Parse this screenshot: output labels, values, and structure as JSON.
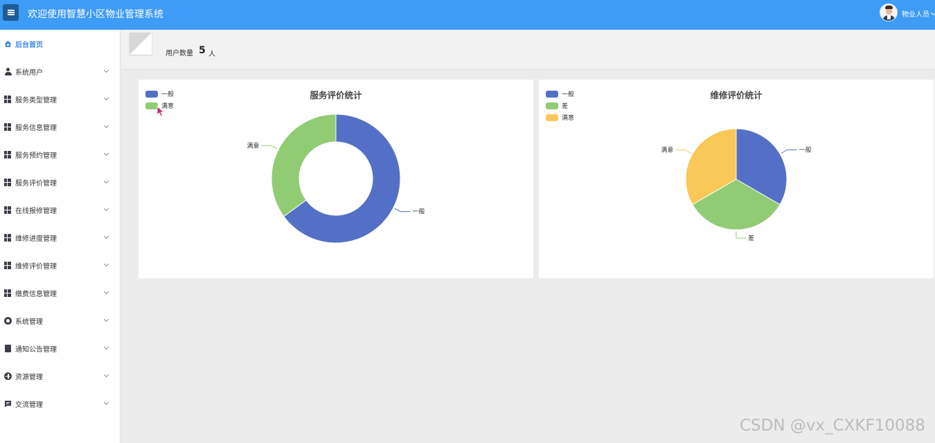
{
  "header": {
    "title": "欢迎使用智慧小区物业管理系统",
    "user_label": "物业人员"
  },
  "sidebar": {
    "items": [
      {
        "label": "后台首页",
        "icon": "home-icon",
        "active": true
      },
      {
        "label": "系统用户",
        "icon": "user-icon"
      },
      {
        "label": "服务类型管理",
        "icon": "grid-icon"
      },
      {
        "label": "服务信息管理",
        "icon": "grid-icon"
      },
      {
        "label": "服务预约管理",
        "icon": "grid-icon"
      },
      {
        "label": "服务评价管理",
        "icon": "grid-icon"
      },
      {
        "label": "在线报修管理",
        "icon": "grid-icon"
      },
      {
        "label": "维修进度管理",
        "icon": "grid-icon"
      },
      {
        "label": "维修评价管理",
        "icon": "grid-icon"
      },
      {
        "label": "缴费信息管理",
        "icon": "grid-icon"
      },
      {
        "label": "系统管理",
        "icon": "gear-icon"
      },
      {
        "label": "通知公告管理",
        "icon": "document-icon"
      },
      {
        "label": "资源管理",
        "icon": "plus-circle-icon"
      },
      {
        "label": "交流管理",
        "icon": "chat-icon"
      }
    ]
  },
  "stats": {
    "user_count_label": "用户数量",
    "user_count_value": "5",
    "user_count_unit": "人"
  },
  "colors": {
    "header_bg": "#3e9bf6",
    "accent": "#3e8ae6",
    "series_blue": "#5470c6",
    "series_green": "#91cc75",
    "series_yellow": "#fac858"
  },
  "chart_data": [
    {
      "type": "pie",
      "variant": "donut",
      "title": "服务评价统计",
      "legend_position": "top-left",
      "categories": [
        "一般",
        "满意"
      ],
      "values": [
        65,
        35
      ],
      "colors": [
        "#5470c6",
        "#91cc75"
      ]
    },
    {
      "type": "pie",
      "title": "维修评价统计",
      "legend_position": "top-left",
      "categories": [
        "一般",
        "差",
        "满意"
      ],
      "values": [
        1,
        1,
        1
      ],
      "colors": [
        "#5470c6",
        "#91cc75",
        "#fac858"
      ]
    }
  ],
  "watermark": "CSDN @vx_CXKF10088"
}
